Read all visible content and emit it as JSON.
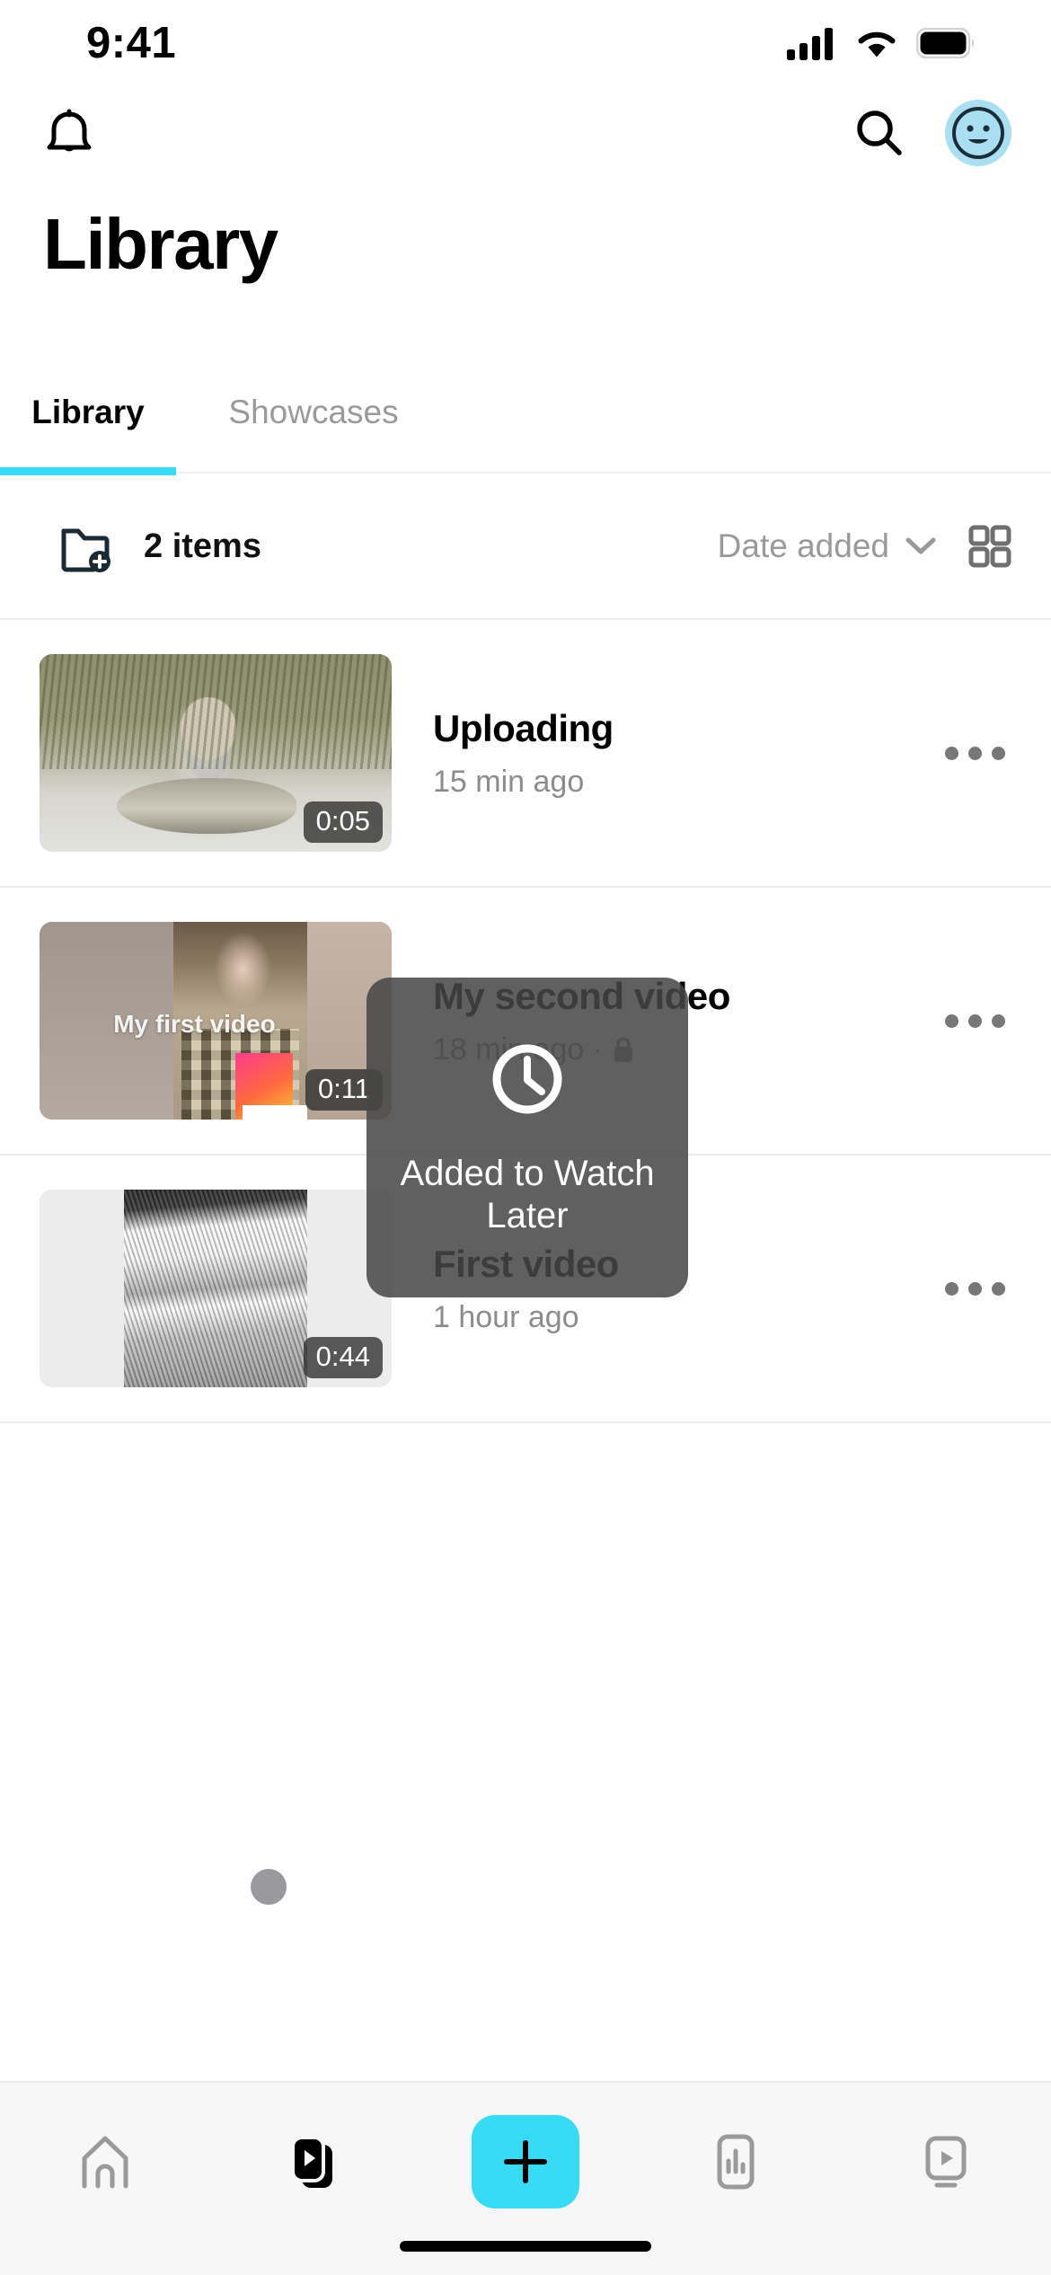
{
  "status_bar": {
    "time": "9:41",
    "cellular_icon": "cellular-signal-icon",
    "wifi_icon": "wifi-icon",
    "battery_icon": "battery-icon"
  },
  "nav": {
    "bell_icon": "bell-icon",
    "search_icon": "search-icon",
    "avatar_icon": "avatar-smiley-icon",
    "avatar_bg": "#aadff2"
  },
  "header": {
    "title": "Library"
  },
  "tabs": {
    "active_index": 0,
    "accent": "#35dcf4",
    "items": [
      {
        "label": "Library"
      },
      {
        "label": "Showcases"
      }
    ]
  },
  "filter_bar": {
    "new_folder_icon": "new-folder-icon",
    "items_count": "2 items",
    "sort_label": "Date added",
    "chevron_icon": "chevron-down-icon",
    "grid_view_icon": "grid-view-icon"
  },
  "videos": [
    {
      "title": "Uploading",
      "meta": "15 min ago",
      "duration": "0:05",
      "private": false,
      "thumb_art": "fisherman-holding-carp",
      "thumb_caption": "",
      "more_icon": "more-options-icon"
    },
    {
      "title": "My second video",
      "meta": "18 min ago · ",
      "lock_icon": "lock-icon",
      "duration": "0:11",
      "private": true,
      "thumb_art": "woman-in-plaid-shirt",
      "thumb_caption": "My first video",
      "more_icon": "more-options-icon"
    },
    {
      "title": "First video",
      "meta": "1 hour ago",
      "duration": "0:44",
      "private": false,
      "thumb_art": "ice-skate-blade",
      "thumb_caption": "",
      "more_icon": "more-options-icon"
    }
  ],
  "toast": {
    "icon": "clock-icon",
    "message": "Added to Watch Later",
    "background": "#464646"
  },
  "touch_indicator": {
    "visible": true,
    "color": "#9a9a9e"
  },
  "bottom_bar": {
    "accent": "#35dcf4",
    "items": [
      {
        "icon": "home-icon",
        "active": false
      },
      {
        "icon": "video-library-icon",
        "active": true
      },
      {
        "icon": "plus-icon",
        "active": false
      },
      {
        "icon": "analytics-icon",
        "active": false
      },
      {
        "icon": "tv-cast-icon",
        "active": false
      }
    ],
    "home_indicator": "home-indicator"
  }
}
